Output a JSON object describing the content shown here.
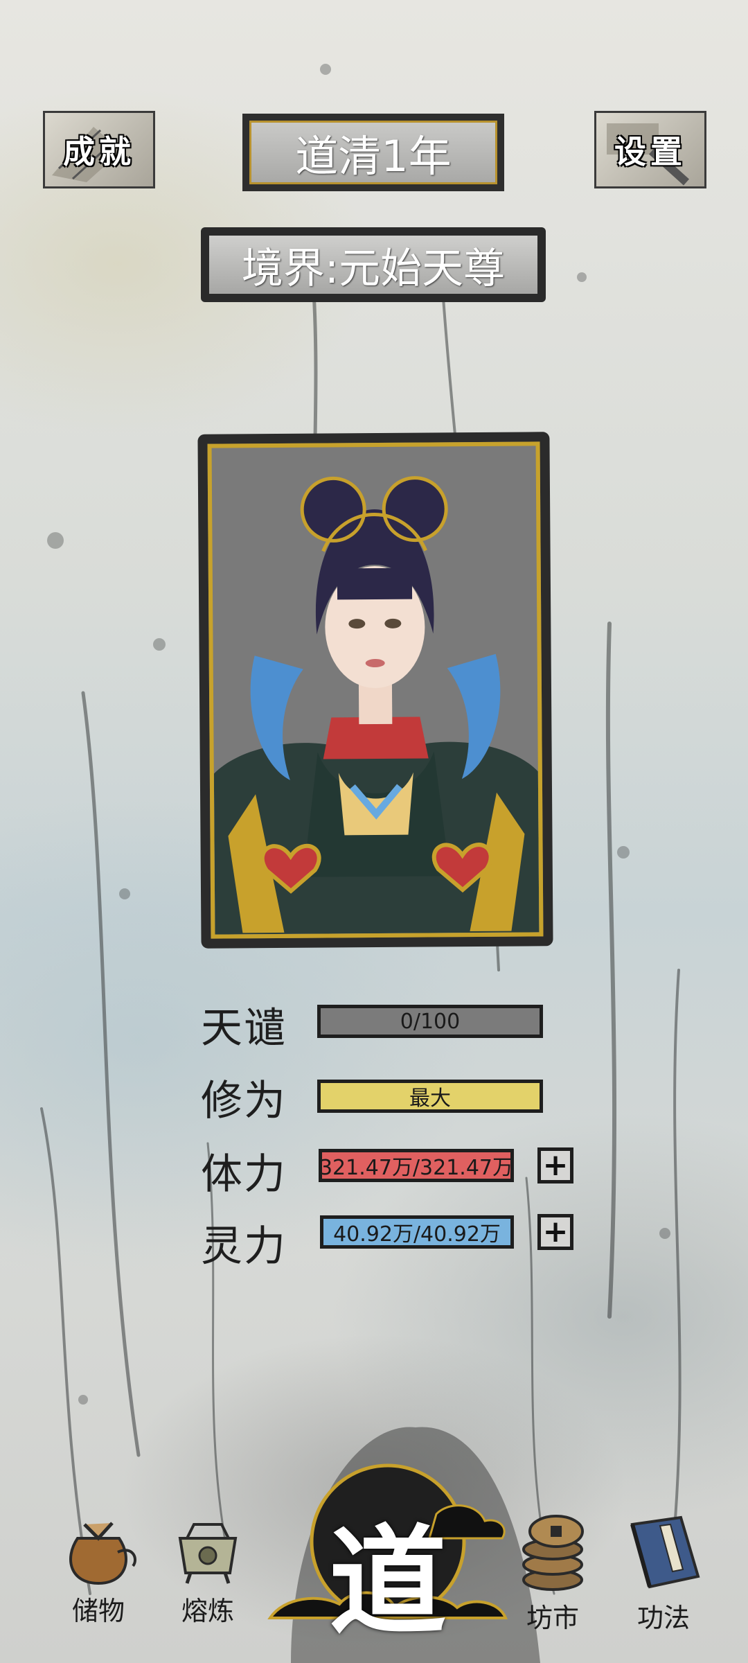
{
  "header": {
    "achievements_label": "成就",
    "settings_label": "设置",
    "year": "道清1年",
    "realm": "境界:元始天尊"
  },
  "stats": {
    "tribulation": {
      "label": "天谴",
      "value": "0/100",
      "color": "#7b7b7b"
    },
    "cultivation": {
      "label": "修为",
      "value": "最大",
      "color": "#e3d26a"
    },
    "stamina": {
      "label": "体力",
      "value": "321.47万/321.47万",
      "color": "#e06060"
    },
    "spirit": {
      "label": "灵力",
      "value": "40.92万/40.92万",
      "color": "#79b3de"
    },
    "plus_symbol": "+"
  },
  "nav": {
    "storage": "储物",
    "smelting": "熔炼",
    "dao": "道",
    "market": "坊市",
    "techniques": "功法"
  }
}
